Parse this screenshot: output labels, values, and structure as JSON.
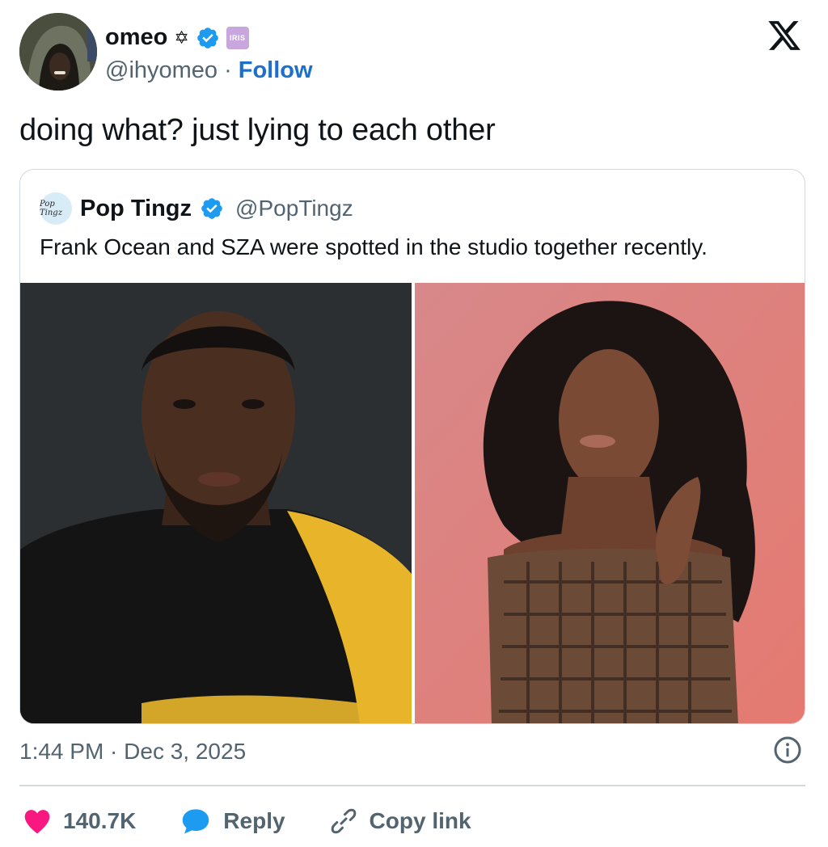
{
  "author": {
    "display_name": "omeo",
    "handle": "@ihyomeo",
    "separator": "·",
    "follow_label": "Follow",
    "badge_text": "IRIS"
  },
  "tweet": {
    "text": "doing what? just lying to each other",
    "time": "1:44 PM · Dec 3, 2025"
  },
  "quote": {
    "name": "Pop Tingz",
    "handle": "@PopTingz",
    "avatar_text": "Pop Tingz",
    "text": "Frank Ocean and SZA were spotted in the studio together recently."
  },
  "actions": {
    "likes": "140.7K",
    "reply_label": "Reply",
    "copy_label": "Copy link"
  },
  "colors": {
    "verified": "#1d9bf0",
    "like": "#f91880",
    "reply": "#1d9bf0",
    "follow": "#1d70c9"
  },
  "icons": [
    "star-icon",
    "verified-icon",
    "x-logo-icon",
    "info-icon",
    "heart-icon",
    "reply-bubble-icon",
    "link-icon"
  ]
}
